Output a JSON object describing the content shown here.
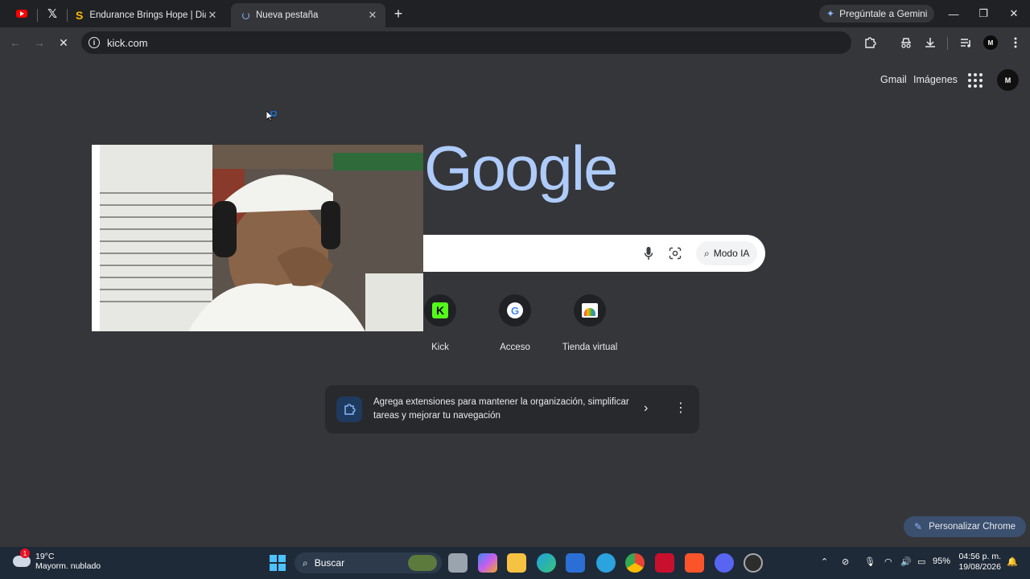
{
  "tabs": {
    "pinned": [
      {
        "name": "youtube",
        "icon": "youtube-icon"
      },
      {
        "name": "x",
        "icon": "x-icon"
      }
    ],
    "items": [
      {
        "title": "Endurance Brings Hope | Diapo",
        "close": "✕"
      },
      {
        "title": "Nueva pestaña",
        "close": "✕",
        "active": true
      }
    ],
    "new_tab": "+",
    "gemini_label": "Pregúntale a Gemini"
  },
  "window_controls": {
    "minimize": "—",
    "restore": "❐",
    "close": "✕"
  },
  "toolbar": {
    "back": "←",
    "forward": "→",
    "stop": "✕",
    "url": "kick.com",
    "profile_initial": "M"
  },
  "page": {
    "gmail": "Gmail",
    "images": "Imágenes",
    "account_initial": "M",
    "logo": "Google",
    "search": {
      "ai_mode": "Modo IA"
    },
    "shortcuts": [
      {
        "label": "Kick",
        "icon": "kick-icon"
      },
      {
        "label": "Acceso",
        "icon": "google-icon"
      },
      {
        "label": "Tienda virtual",
        "icon": "web-store-icon"
      }
    ],
    "extension_card": {
      "text": "Agrega extensiones para mantener la organización, simplificar tareas y mejorar tu navegación"
    },
    "customize_label": "Personalizar Chrome"
  },
  "taskbar": {
    "weather": {
      "temp": "19°C",
      "condition": "Mayorm. nublado",
      "badge": "1"
    },
    "search_label": "Buscar",
    "battery": "95%",
    "time": "04:56 p. m.",
    "date": "19/08/2026",
    "colors": {
      "accent": "#4cc2ff",
      "background": "#1f2a38"
    }
  }
}
